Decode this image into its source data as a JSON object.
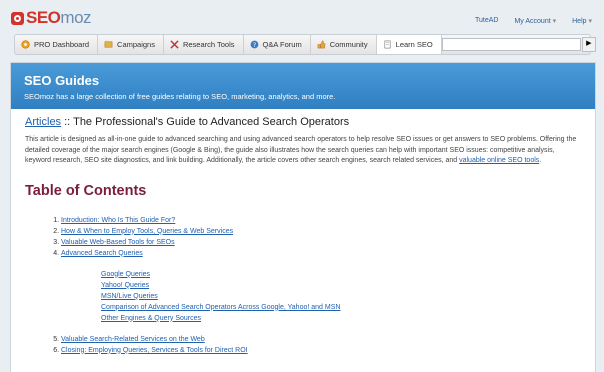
{
  "brand": {
    "seo": "SEO",
    "moz": "moz",
    "logo_color": "#d0342c"
  },
  "toplinks": [
    "TuteAD",
    "My Account",
    "Help"
  ],
  "nav": {
    "items": [
      {
        "label": "PRO Dashboard",
        "icon": "pro-dashboard-icon"
      },
      {
        "label": "Campaigns",
        "icon": "campaigns-icon"
      },
      {
        "label": "Research Tools",
        "icon": "research-tools-icon"
      },
      {
        "label": "Q&A Forum",
        "icon": "qa-forum-icon"
      },
      {
        "label": "Community",
        "icon": "community-icon"
      },
      {
        "label": "Learn SEO",
        "icon": "learn-seo-icon"
      }
    ],
    "search_value": "",
    "search_button": "▶"
  },
  "banner": {
    "title": "SEO Guides",
    "subtitle": "SEOmoz has a large collection of free guides relating to SEO, marketing, analytics, and more."
  },
  "article": {
    "crumb": "Articles",
    "sep": " :: ",
    "title": "The Professional's Guide to Advanced Search Operators",
    "intro": "This article is designed as all-in-one guide to advanced searching and using advanced search operators to help resolve SEO issues or get answers to SEO problems. Offering the detailed coverage of the major search engines (Google & Bing), the guide also illustrates how the search queries can help with important SEO issues: competitive analysis, keyword research, SEO site diagnostics, and link building. Additionally, the article covers other search engines, search related services, and ",
    "intro_link": "valuable online SEO tools",
    "intro_end": "."
  },
  "toc": {
    "title": "Table of Contents",
    "items": [
      "Introduction: Who Is This Guide For?",
      "How & When to Employ Tools, Queries & Web Services",
      "Valuable Web-Based Tools for SEOs",
      "Advanced Search Queries",
      "Valuable Search-Related Services on the Web",
      "Closing: Employing Queries, Services & Tools for Direct ROI"
    ],
    "sub_items": [
      "Google Queries",
      "Yahoo! Queries",
      "MSN/Live Queries",
      "Comparison of Advanced Search Operators Across Google, Yahoo! and MSN",
      "Other Engines & Query Sources"
    ]
  }
}
